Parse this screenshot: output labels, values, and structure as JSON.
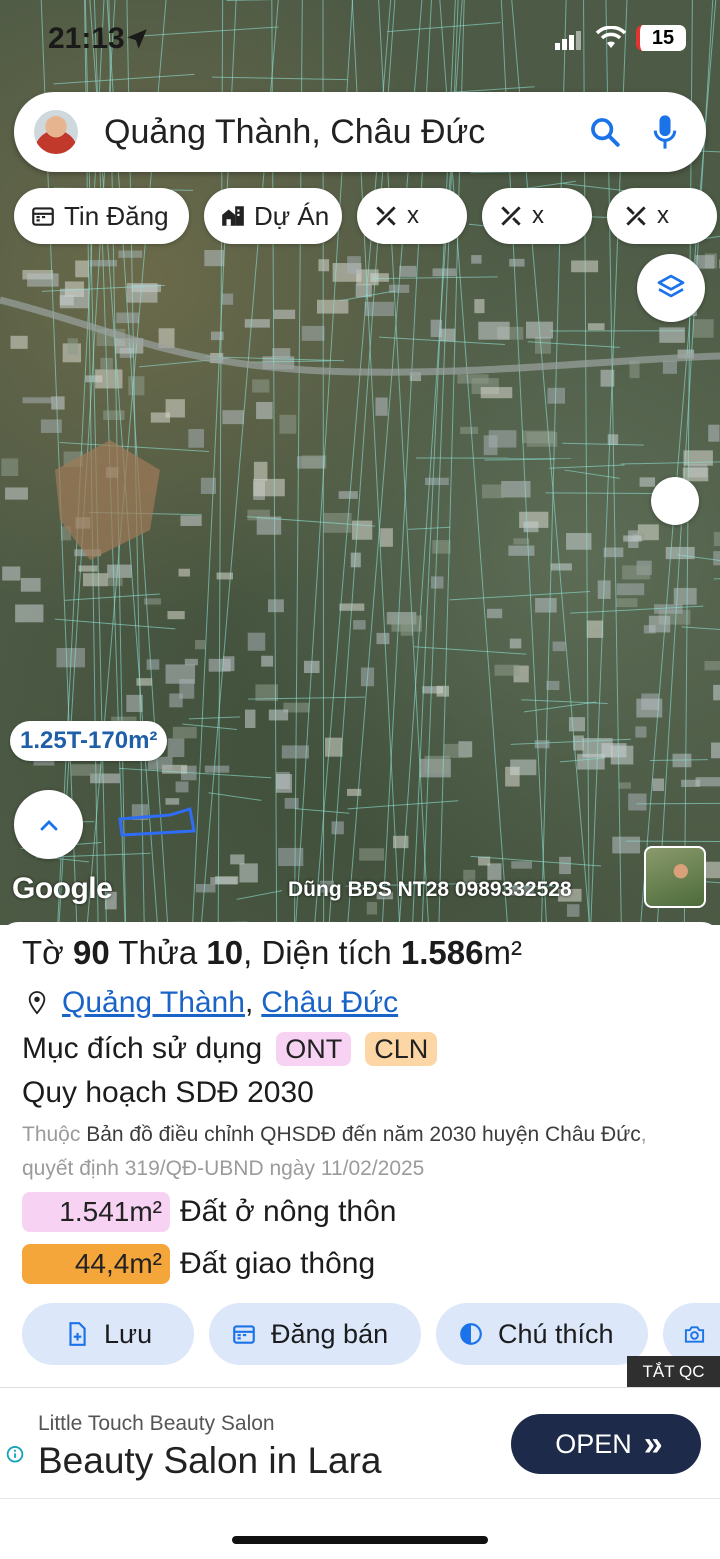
{
  "status": {
    "time": "21:13",
    "battery": "15"
  },
  "search": {
    "text": "Quảng Thành, Châu Đức"
  },
  "chips": [
    {
      "label": "Tin Đăng",
      "icon": "calendar-icon"
    },
    {
      "label": "Dự Án",
      "icon": "building-icon"
    },
    {
      "label": "x",
      "icon": "ruler-pencil-icon"
    },
    {
      "label": "x",
      "icon": "ruler-pencil-icon"
    },
    {
      "label": "x",
      "icon": "ruler-pencil-icon"
    }
  ],
  "map": {
    "price_tag": "1.25T-170m²",
    "google_logo": "Google",
    "watermark": "Dũng BĐS NT28 0989332528"
  },
  "parcel": {
    "title_prefix": "Tờ",
    "sheet": "90",
    "plot_label": "Thửa",
    "plot": "10",
    "area_label": ", Diện tích",
    "area": "1.586",
    "area_unit": "m²",
    "ward": "Quảng Thành",
    "district": "Châu Đức",
    "use_label": "Mục đích sử dụng",
    "use_codes": [
      {
        "code": "ONT",
        "color": "#f7d2f3"
      },
      {
        "code": "CLN",
        "color": "#fcd6a5"
      }
    ],
    "plan_title": "Quy hoạch SDĐ 2030",
    "note_prefix": "Thuộc",
    "note_map": "Bản đồ điều chỉnh QHSDĐ đến năm 2030 huyện Châu Đức",
    "note_suffix": ", quyết định 319/QĐ-UBND ngày 11/02/2025",
    "areas": [
      {
        "value": "1.541m²",
        "label": "Đất ở nông thôn",
        "color": "#f7d2f3"
      },
      {
        "value": "44,4m²",
        "label": "Đất giao thông",
        "color": "#f5a63a"
      }
    ]
  },
  "actions": [
    {
      "label": "Lưu",
      "icon": "add-file-icon"
    },
    {
      "label": "Đăng bán",
      "icon": "calendar-icon"
    },
    {
      "label": "Chú thích",
      "icon": "contrast-icon"
    },
    {
      "label": "",
      "icon": "camera-add-icon"
    }
  ],
  "ads_off": "TẮT QC",
  "ad": {
    "brand": "Little Touch Beauty Salon",
    "headline": "Beauty Salon in Lara",
    "cta": "OPEN",
    "cta_chevron": "»"
  }
}
